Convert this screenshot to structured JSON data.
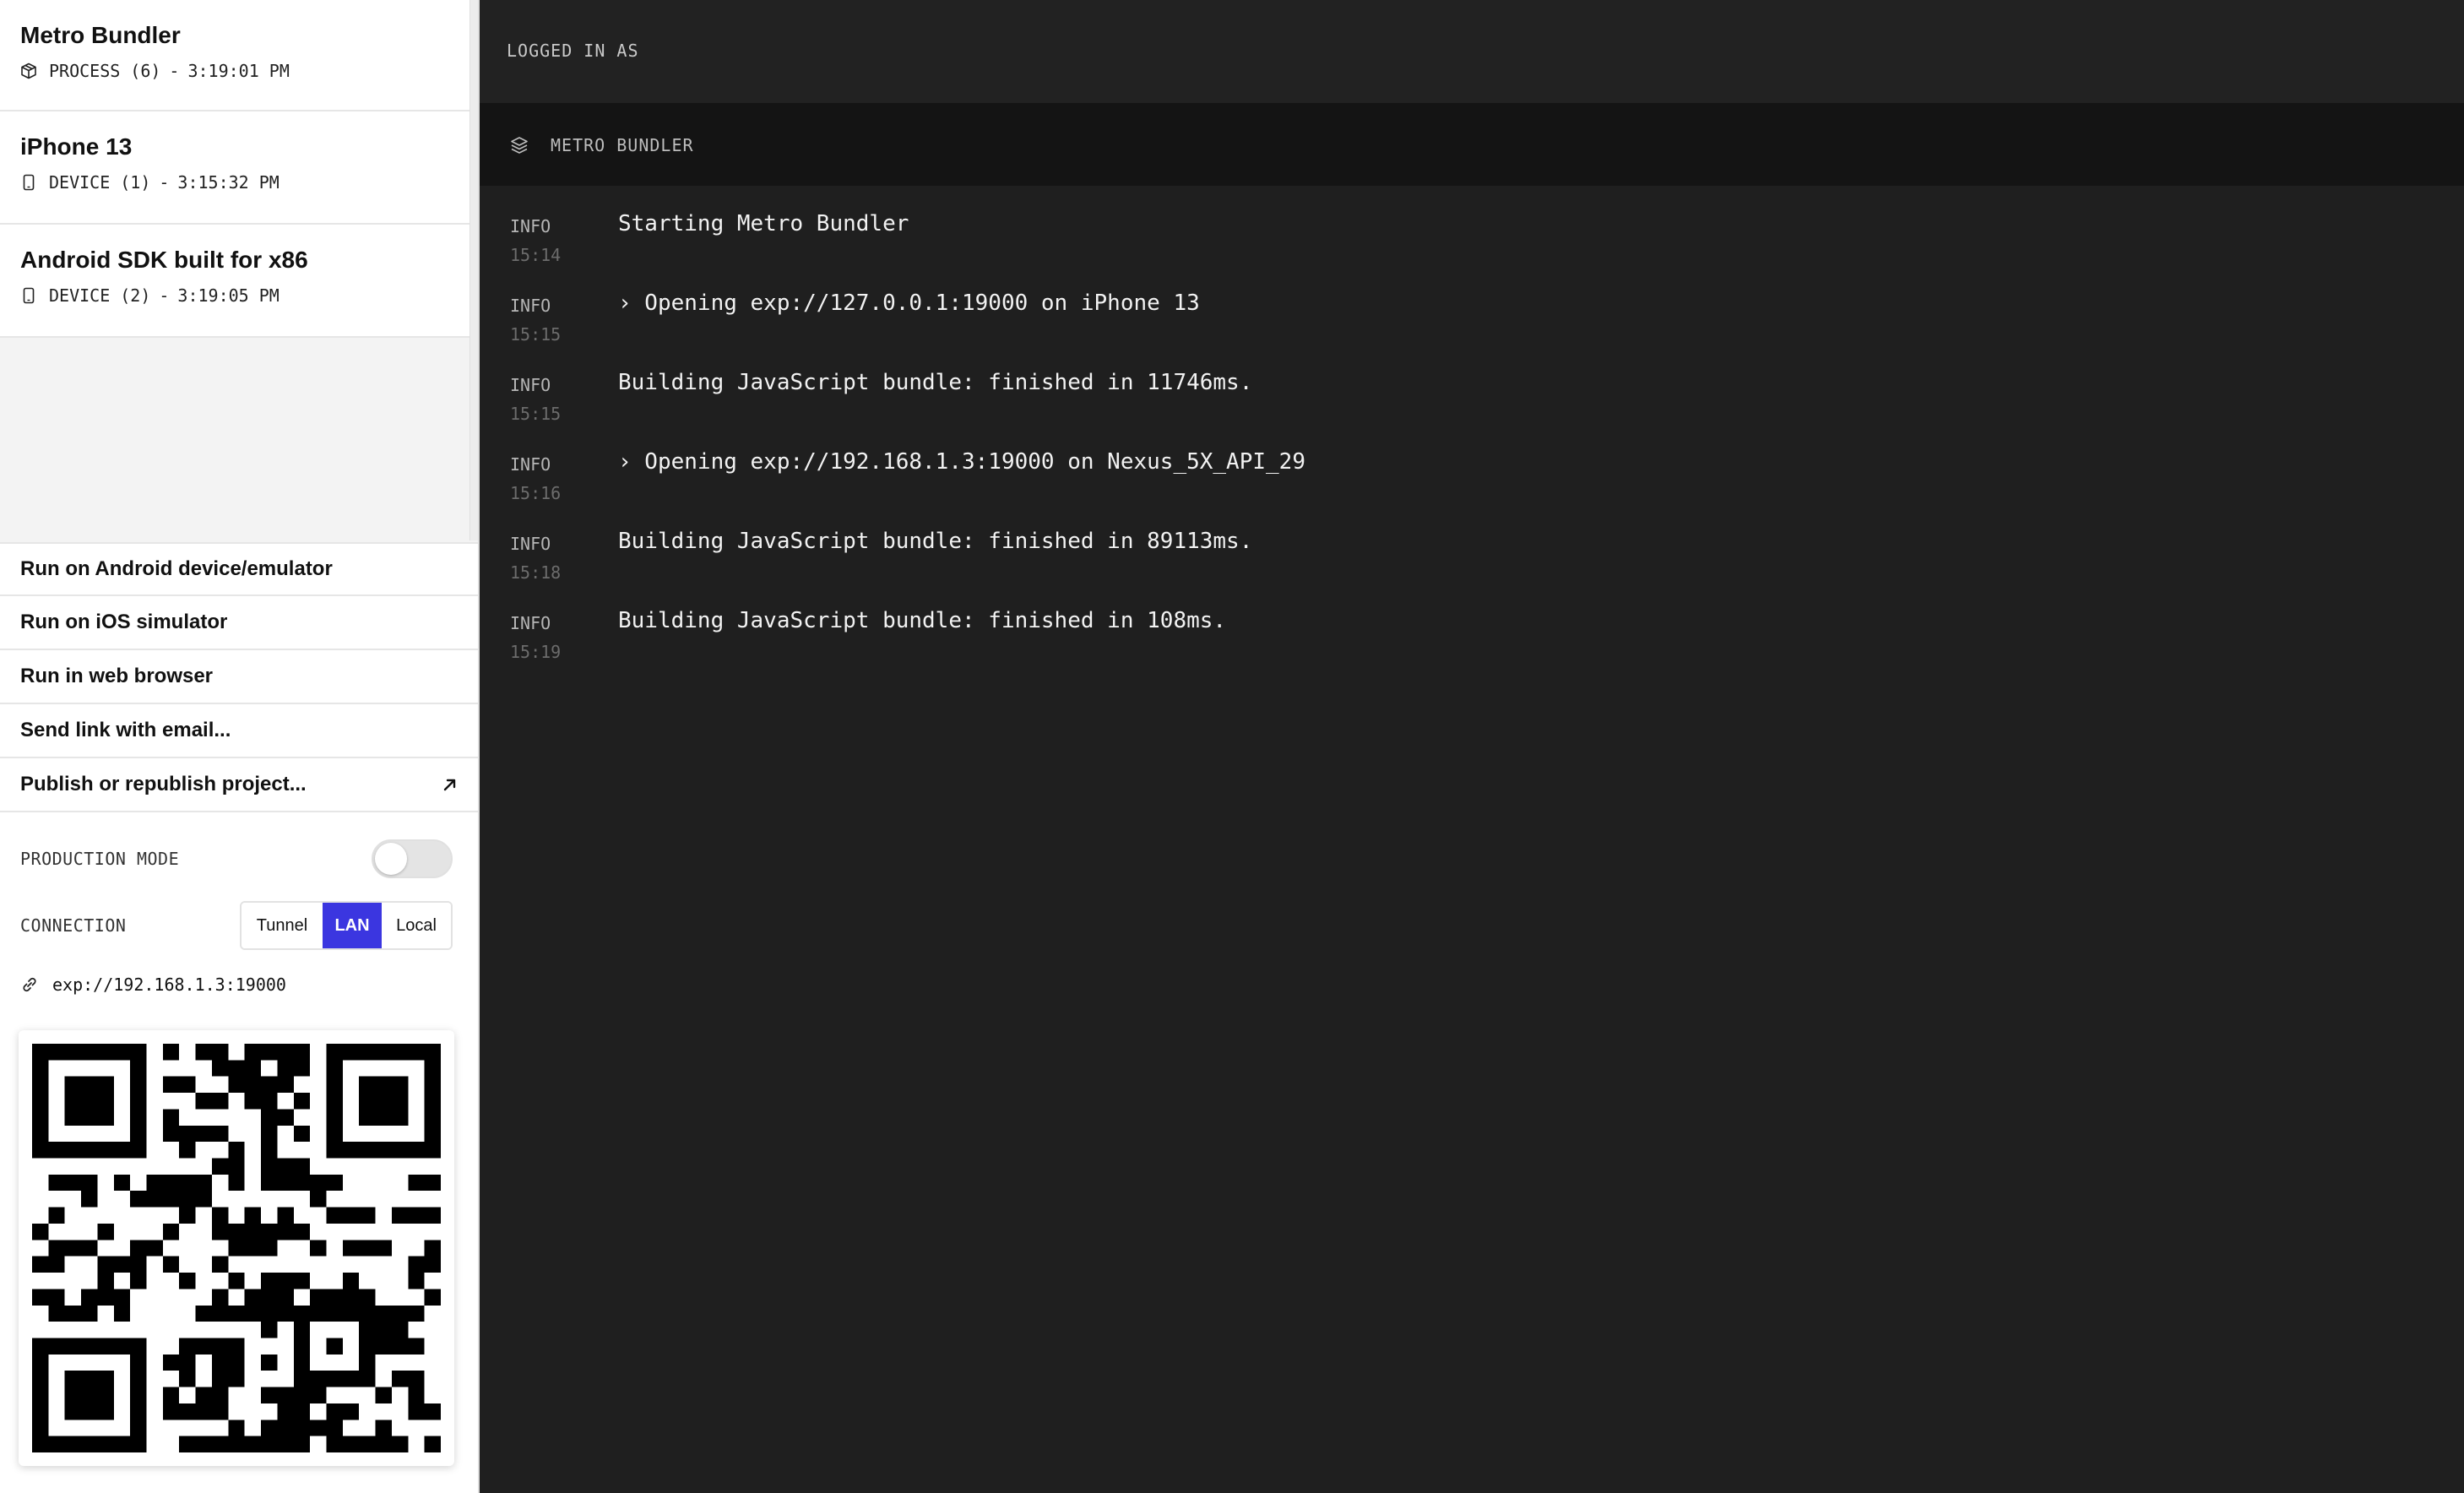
{
  "sidebar": {
    "processes": [
      {
        "title": "Metro Bundler",
        "icon": "package-icon",
        "kind": "PROCESS",
        "id": "(6)",
        "sep": "-",
        "time": "3:19:01 PM"
      },
      {
        "title": "iPhone 13",
        "icon": "device-icon",
        "kind": "DEVICE",
        "id": "(1)",
        "sep": "-",
        "time": "3:15:32 PM"
      },
      {
        "title": "Android SDK built for x86",
        "icon": "device-icon",
        "kind": "DEVICE",
        "id": "(2)",
        "sep": "-",
        "time": "3:19:05 PM"
      }
    ],
    "actions": [
      {
        "label": "Run on Android device/emulator"
      },
      {
        "label": "Run on iOS simulator"
      },
      {
        "label": "Run in web browser"
      },
      {
        "label": "Send link with email..."
      },
      {
        "label": "Publish or republish project...",
        "icon": "arrow-up-right-icon"
      }
    ],
    "production_mode": {
      "label": "PRODUCTION MODE",
      "enabled": false
    },
    "connection": {
      "label": "CONNECTION",
      "options": [
        "Tunnel",
        "LAN",
        "Local"
      ],
      "selected": "LAN"
    },
    "url": {
      "icon": "link-icon",
      "value": "exp://192.168.1.3:19000"
    },
    "qr": {
      "icon": "qr-code-icon"
    }
  },
  "main": {
    "logged_in_label": "LOGGED IN AS",
    "tab": {
      "icon": "layers-icon",
      "label": "METRO BUNDLER"
    },
    "logs": [
      {
        "level": "INFO",
        "time": "15:14",
        "message": "Starting Metro Bundler"
      },
      {
        "level": "INFO",
        "time": "15:15",
        "message": "› Opening exp://127.0.0.1:19000 on iPhone 13"
      },
      {
        "level": "INFO",
        "time": "15:15",
        "message": "Building JavaScript bundle: finished in 11746ms."
      },
      {
        "level": "INFO",
        "time": "15:16",
        "message": "› Opening exp://192.168.1.3:19000 on Nexus_5X_API_29"
      },
      {
        "level": "INFO",
        "time": "15:18",
        "message": "Building JavaScript bundle: finished in 89113ms."
      },
      {
        "level": "INFO",
        "time": "15:19",
        "message": "Building JavaScript bundle: finished in 108ms."
      }
    ]
  },
  "colors": {
    "accent": "#3b36e0",
    "main_bg": "#1f1f1f",
    "tabbar_bg": "#141414"
  }
}
